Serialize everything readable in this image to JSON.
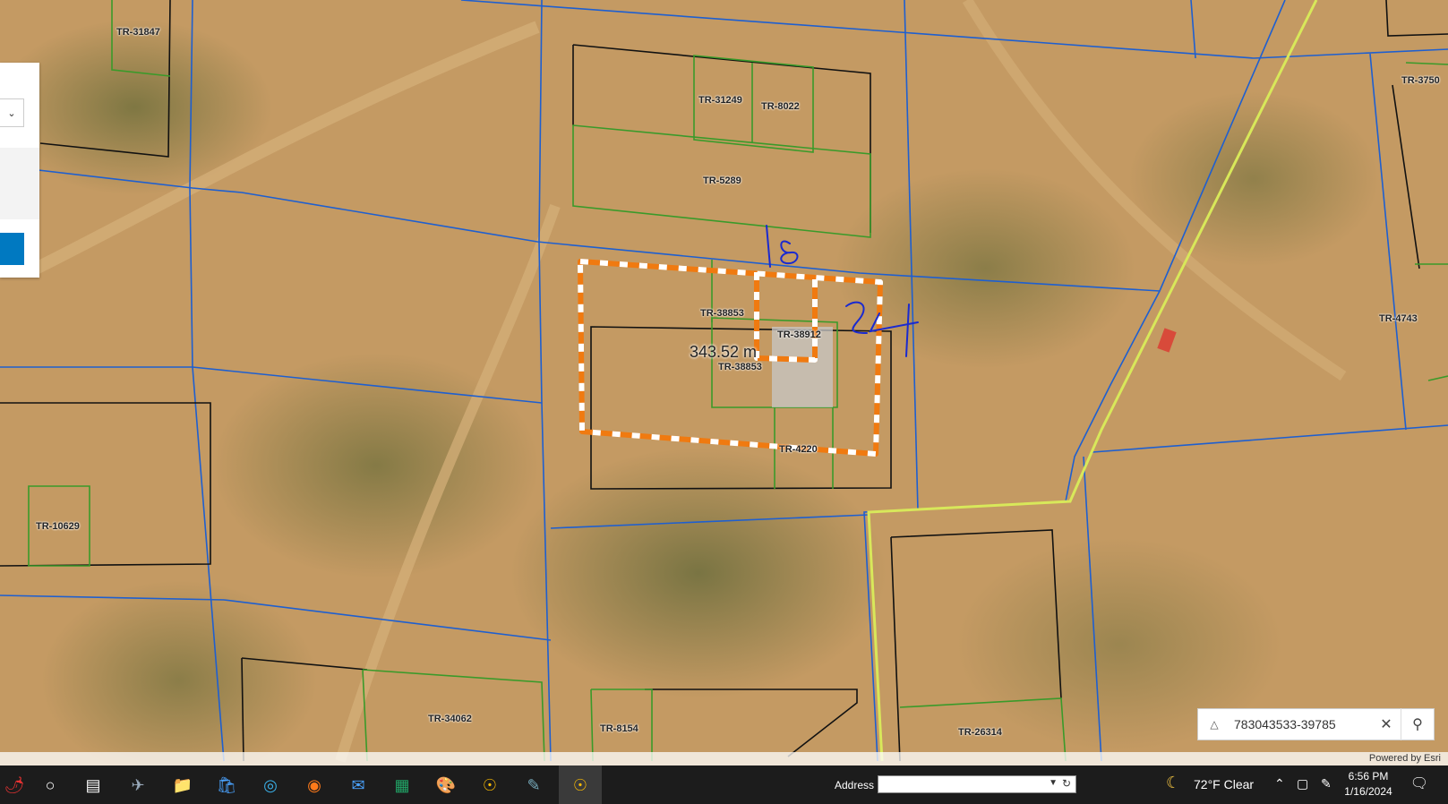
{
  "map": {
    "parcel_labels": [
      {
        "id": "p1",
        "text": "TR-31847"
      },
      {
        "id": "p2",
        "text": "TR-31249"
      },
      {
        "id": "p3",
        "text": "TR-8022"
      },
      {
        "id": "p4",
        "text": "TR-5289"
      },
      {
        "id": "p5",
        "text": "TR-38853"
      },
      {
        "id": "p6",
        "text": "TR-38912"
      },
      {
        "id": "p7",
        "text": "TR-38853"
      },
      {
        "id": "p8",
        "text": "TR-3750"
      },
      {
        "id": "p9",
        "text": "TR-4743"
      },
      {
        "id": "p10",
        "text": "TR-10629"
      },
      {
        "id": "p11",
        "text": "TR-34062"
      },
      {
        "id": "p12",
        "text": "TR-8154"
      },
      {
        "id": "p13",
        "text": "TR-26314"
      },
      {
        "id": "p14",
        "text": "TR-4220"
      }
    ],
    "measurement": "343.52 m",
    "handwritten_top": "18",
    "handwritten_right": "24",
    "attribution": "Powered by Esri"
  },
  "search": {
    "value": "783043533-39785"
  },
  "taskbar": {
    "address_label": "Address",
    "weather": "72°F  Clear",
    "time": "6:56 PM",
    "date": "1/16/2024"
  },
  "colors": {
    "parcel_blue": "#1e5fd0",
    "parcel_green": "#3a9a2a",
    "parcel_black": "#111111",
    "measure_orange": "#f07a10",
    "esri_blue": "#0079c1"
  }
}
